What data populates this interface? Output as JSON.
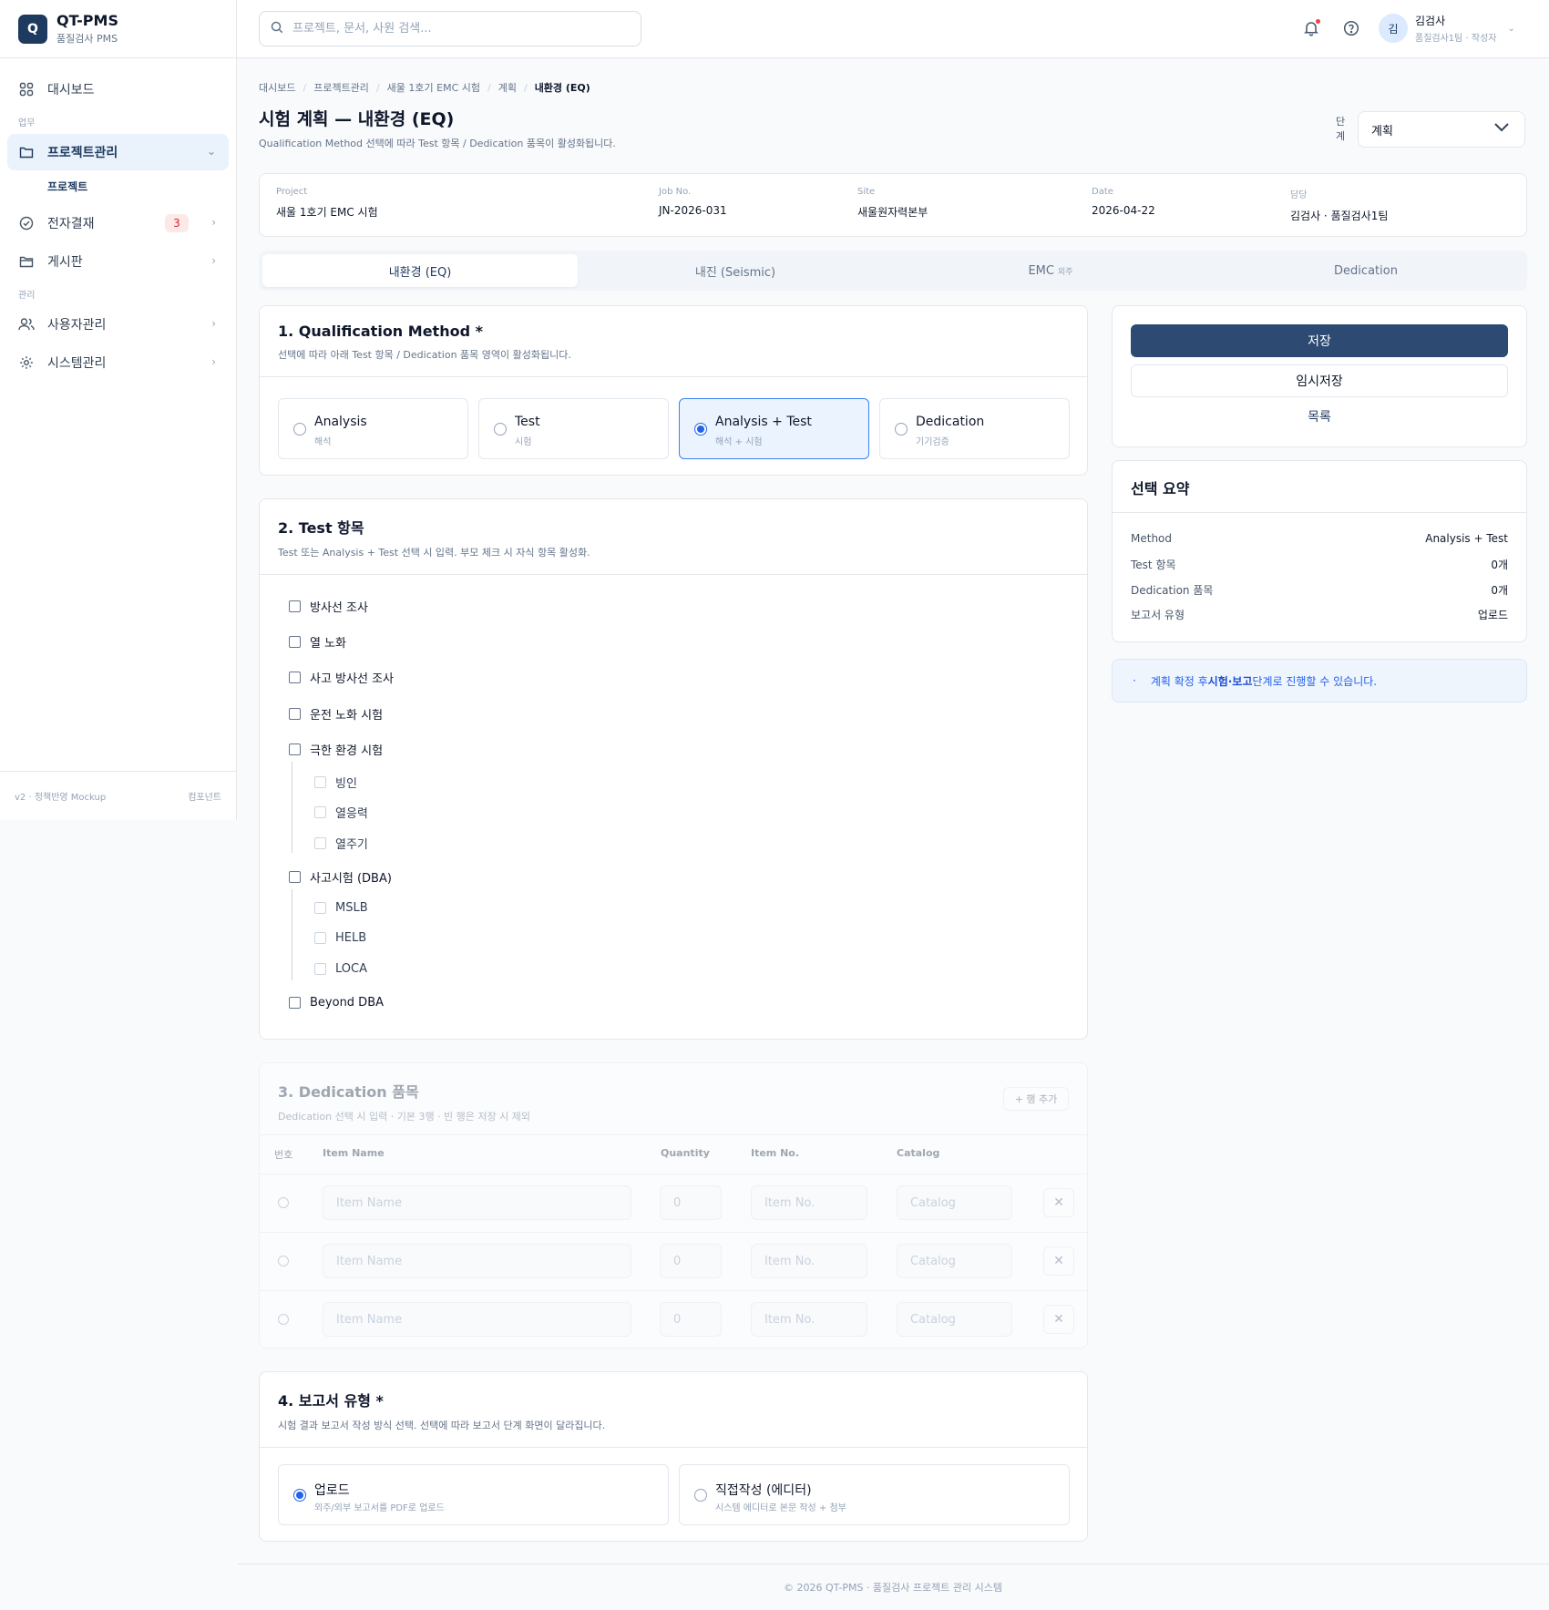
{
  "app": {
    "logo_letter": "Q",
    "name": "QT-PMS",
    "subtitle": "품질검사 PMS"
  },
  "sidebar": {
    "items": [
      {
        "label": "대시보드",
        "icon": "grid-icon"
      },
      {
        "group": "업무"
      },
      {
        "label": "프로젝트관리",
        "icon": "folder-icon",
        "active": true
      },
      {
        "sub": "프로젝트"
      },
      {
        "label": "전자결재",
        "icon": "check-circle-icon",
        "badge": "3"
      },
      {
        "label": "게시판",
        "icon": "folder-open-icon"
      },
      {
        "group": "관리"
      },
      {
        "label": "사용자관리",
        "icon": "users-icon"
      },
      {
        "label": "시스템관리",
        "icon": "gear-icon"
      }
    ],
    "footer_left": "v2 · 정책반영 Mockup",
    "footer_right": "컴포넌트"
  },
  "topbar": {
    "search_placeholder": "프로젝트, 문서, 사원 검색...",
    "user_avatar": "김",
    "user_name": "김검사",
    "user_role": "품질검사1팀 · 작성자"
  },
  "breadcrumb": [
    "대시보드",
    "프로젝트관리",
    "새울 1호기 EMC 시험",
    "계획",
    "내환경 (EQ)"
  ],
  "page": {
    "title": "시험 계획 — 내환경 (EQ)",
    "subtitle": "Qualification Method 선택에 따라 Test 항목 / Dedication 품목이 활성화됩니다.",
    "stage_label": "단계",
    "stage_value": "계획"
  },
  "info": [
    {
      "k": "Project",
      "v": "새울 1호기 EMC 시험"
    },
    {
      "k": "Job No.",
      "v": "JN-2026-031"
    },
    {
      "k": "Site",
      "v": "새울원자력본부"
    },
    {
      "k": "Date",
      "v": "2026-04-22"
    },
    {
      "k": "담당",
      "v": "김검사 · 품질검사1팀"
    }
  ],
  "tabs": [
    {
      "label": "내환경 (EQ)",
      "active": true
    },
    {
      "label": "내진 (Seismic)"
    },
    {
      "label": "EMC",
      "tag": "외주"
    },
    {
      "label": "Dedication"
    }
  ],
  "qm": {
    "title": "1. Qualification Method *",
    "desc": "선택에 따라 아래 Test 항목 / Dedication 품목 영역이 활성화됩니다.",
    "options": [
      {
        "t": "Analysis",
        "s": "해석"
      },
      {
        "t": "Test",
        "s": "시험"
      },
      {
        "t": "Analysis + Test",
        "s": "해석 + 시험",
        "selected": true
      },
      {
        "t": "Dedication",
        "s": "기기검증"
      }
    ]
  },
  "test": {
    "title": "2. Test 항목",
    "desc": "Test 또는 Analysis + Test 선택 시 입력. 부모 체크 시 자식 항목 활성화.",
    "items": [
      "방사선 조사",
      "열 노화",
      "사고 방사선 조사",
      "운전 노화 시험",
      "극한 환경 시험",
      "빙인",
      "열응력",
      "열주기",
      "사고시험 (DBA)",
      "MSLB",
      "HELB",
      "LOCA",
      "Beyond DBA"
    ]
  },
  "ded": {
    "title": "3. Dedication 품목",
    "desc": "Dedication 선택 시 입력 · 기본 3행 · 빈 행은 저장 시 제외",
    "add_label": "+ 행 추가",
    "cols": [
      "번호",
      "Item Name",
      "Quantity",
      "Item No.",
      "Catalog"
    ],
    "ph_name": "Item Name",
    "ph_qty": "0",
    "ph_no": "Item No.",
    "ph_cat": "Catalog",
    "del": "✕"
  },
  "report": {
    "title": "4. 보고서 유형 *",
    "desc": "시험 결과 보고서 작성 방식 선택. 선택에 따라 보고서 단계 화면이 달라집니다.",
    "options": [
      {
        "t": "업로드",
        "s": "외주/외부 보고서를 PDF로 업로드",
        "selected": true
      },
      {
        "t": "직접작성 (에디터)",
        "s": "시스템 에디터로 본문 작성 + 첨부"
      }
    ]
  },
  "actions": {
    "save": "저장",
    "draft": "임시저장",
    "list": "목록"
  },
  "summary": {
    "title": "선택 요약",
    "rows": [
      {
        "k": "Method",
        "v": "Analysis + Test"
      },
      {
        "k": "Test 항목",
        "v": "0개"
      },
      {
        "k": "Dedication 품목",
        "v": "0개"
      },
      {
        "k": "보고서 유형",
        "v": "업로드"
      }
    ]
  },
  "notice": {
    "pre": "계획 확정 후 ",
    "bold": "시험·보고",
    "post": " 단계로 진행할 수 있습니다."
  },
  "footer": "© 2026 QT-PMS · 품질검사 프로젝트 관리 시스템"
}
